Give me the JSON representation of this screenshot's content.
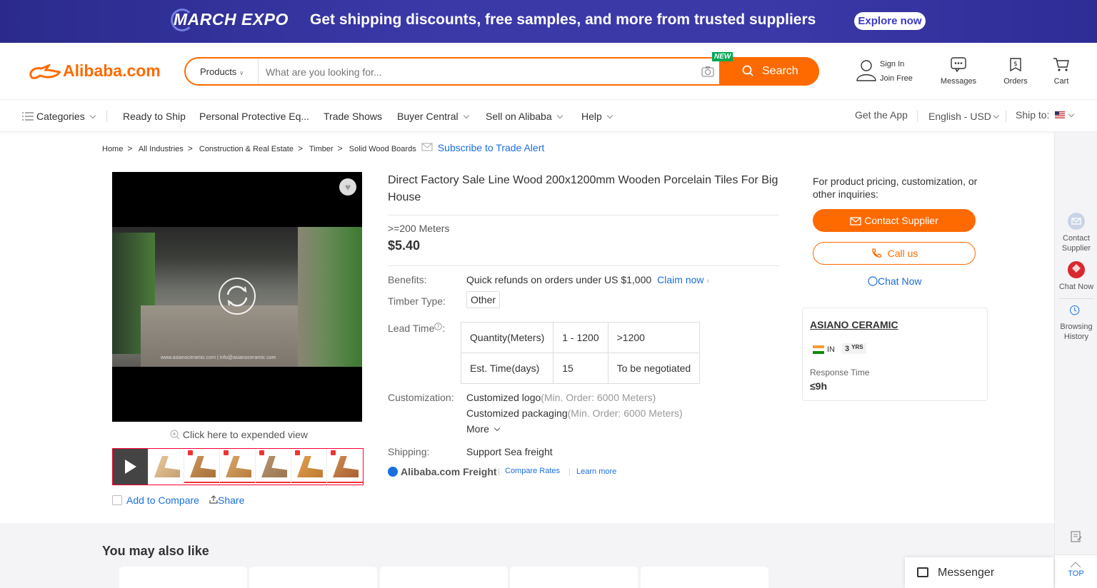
{
  "banner": {
    "logo": "MARCH EXPO",
    "text": "Get shipping discounts, free samples, and more from trusted suppliers",
    "cta": "Explore now"
  },
  "header": {
    "logo": "Alibaba.com",
    "search": {
      "category": "Products",
      "placeholder": "What are you looking for...",
      "button": "Search",
      "new_tag": "NEW"
    },
    "signin": "Sign In",
    "joinfree": "Join Free",
    "messages": "Messages",
    "orders": "Orders",
    "cart": "Cart"
  },
  "nav": {
    "categories": "Categories",
    "items": [
      "Ready to Ship",
      "Personal Protective Eq...",
      "Trade Shows",
      "Buyer Central",
      "Sell on Alibaba",
      "Help"
    ],
    "get_app": "Get the App",
    "language": "English - USD",
    "ship_to": "Ship to:"
  },
  "breadcrumb": {
    "items": [
      "Home",
      "All Industries",
      "Construction & Real Estate",
      "Timber",
      "Solid Wood Boards"
    ],
    "separator": ">",
    "subscribe": "Subscribe to Trade Alert"
  },
  "gallery": {
    "expand": "Click here to expended view",
    "watermark": "www.asianoceramic.com | info@asianoceramic.com",
    "add_compare": "Add to Compare",
    "share": "Share"
  },
  "product": {
    "title": "Direct Factory Sale Line Wood 200x1200mm Wooden Porcelain Tiles For Big House",
    "moq": ">=200 Meters",
    "price": "$5.40",
    "benefits_label": "Benefits:",
    "benefits": "Quick refunds on orders under US $1,000",
    "claim": "Claim now",
    "timber_label": "Timber Type:",
    "timber": "Other",
    "lead_label": "Lead Time",
    "lead_table": {
      "header": [
        "Quantity(Meters)",
        "1 - 1200",
        ">1200"
      ],
      "row": [
        "Est. Time(days)",
        "15",
        "To be negotiated"
      ]
    },
    "custom_label": "Customization:",
    "custom1": "Customized logo",
    "custom1_note": "(Min. Order: 6000 Meters)",
    "custom2": "Customized packaging",
    "custom2_note": "(Min. Order: 6000 Meters)",
    "more": "More",
    "shipping_label": "Shipping:",
    "shipping": "Support Sea freight",
    "freight": "Alibaba.com Freight",
    "compare_rates": "Compare Rates",
    "learn_more": "Learn more"
  },
  "supplier": {
    "inquiry": "For product pricing, customization, or other inquiries:",
    "contact": "Contact Supplier",
    "call": "Call us",
    "chat": "Chat Now",
    "name": "ASIANO CERAMIC",
    "country": "IN",
    "years": "3",
    "years_unit": "YRS",
    "response_label": "Response Time",
    "response_value": "≤9h"
  },
  "sidebar": {
    "contact": "Contact Supplier",
    "chat": "Chat Now",
    "history": "Browsing History",
    "top": "TOP"
  },
  "bottom": {
    "title": "You may also like",
    "messenger": "Messenger"
  },
  "colors": {
    "accent": "#ff6a00",
    "link": "#1a6fdd",
    "banner": "#3b39a8"
  }
}
